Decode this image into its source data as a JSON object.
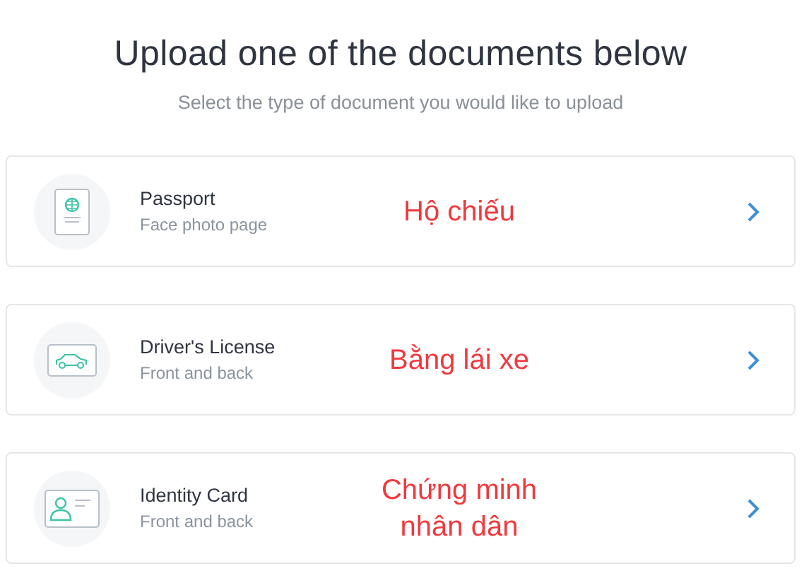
{
  "title": "Upload one of the documents below",
  "subtitle": "Select the type of document you would like to upload",
  "documents": [
    {
      "kind": "passport",
      "name": "Passport",
      "detail": "Face photo page",
      "annotation": "Hộ chiếu"
    },
    {
      "kind": "license",
      "name": "Driver's License",
      "detail": "Front and back",
      "annotation": "Bằng lái xe"
    },
    {
      "kind": "identity",
      "name": "Identity Card",
      "detail": "Front and back",
      "annotation": "Chứng minh nhân dân"
    }
  ]
}
